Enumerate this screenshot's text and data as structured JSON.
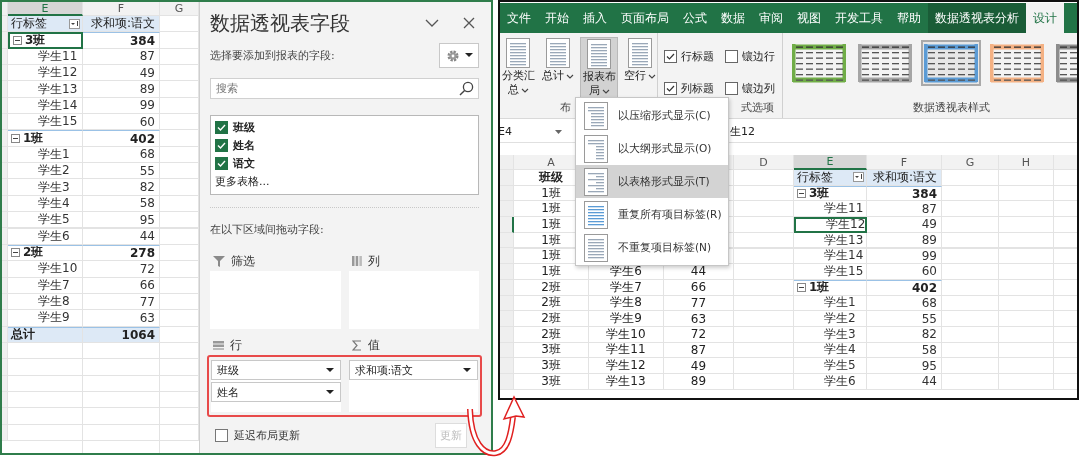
{
  "left_sheet": {
    "columns": [
      {
        "label": "E",
        "selected": true
      },
      {
        "label": "F",
        "selected": false
      },
      {
        "label": "G",
        "selected": false
      }
    ],
    "pivot": {
      "header": {
        "label": "行标签",
        "value": "求和项:语文"
      },
      "rows": [
        {
          "kind": "group",
          "label": "3班",
          "value": "384",
          "selected": true
        },
        {
          "kind": "item",
          "label": "学生11",
          "value": "87",
          "selected": false
        },
        {
          "kind": "item",
          "label": "学生12",
          "value": "49",
          "selected": false
        },
        {
          "kind": "item",
          "label": "学生13",
          "value": "89",
          "selected": false
        },
        {
          "kind": "item",
          "label": "学生14",
          "value": "99",
          "selected": false
        },
        {
          "kind": "item",
          "label": "学生15",
          "value": "60",
          "selected": false
        },
        {
          "kind": "group",
          "label": "1班",
          "value": "402",
          "selected": false
        },
        {
          "kind": "item",
          "label": "学生1",
          "value": "68",
          "selected": false
        },
        {
          "kind": "item",
          "label": "学生2",
          "value": "55",
          "selected": false
        },
        {
          "kind": "item",
          "label": "学生3",
          "value": "82",
          "selected": false
        },
        {
          "kind": "item",
          "label": "学生4",
          "value": "58",
          "selected": false
        },
        {
          "kind": "item",
          "label": "学生5",
          "value": "95",
          "selected": false
        },
        {
          "kind": "item",
          "label": "学生6",
          "value": "44",
          "selected": false
        },
        {
          "kind": "group",
          "label": "2班",
          "value": "278",
          "selected": false
        },
        {
          "kind": "item",
          "label": "学生10",
          "value": "72",
          "selected": false
        },
        {
          "kind": "item",
          "label": "学生7",
          "value": "66",
          "selected": false
        },
        {
          "kind": "item",
          "label": "学生8",
          "value": "77",
          "selected": false
        },
        {
          "kind": "item",
          "label": "学生9",
          "value": "63",
          "selected": false
        },
        {
          "kind": "total",
          "label": "总计",
          "value": "1064",
          "selected": false
        }
      ]
    }
  },
  "field_pane": {
    "title": "数据透视表字段",
    "prompt": "选择要添加到报表的字段:",
    "search": {
      "placeholder": "搜索"
    },
    "fields": [
      {
        "label": "班级",
        "checked": true
      },
      {
        "label": "姓名",
        "checked": true
      },
      {
        "label": "语文",
        "checked": true
      }
    ],
    "more_link": "更多表格...",
    "areas_prompt": "在以下区域间拖动字段:",
    "areas": [
      {
        "kind": "filter",
        "label": "筛选"
      },
      {
        "kind": "columns",
        "label": "列"
      },
      {
        "kind": "rows",
        "label": "行",
        "items": [
          "班级",
          "姓名"
        ]
      },
      {
        "kind": "values",
        "label": "值",
        "items": [
          "求和项:语文"
        ]
      }
    ],
    "defer_update": {
      "label": "延迟布局更新",
      "checked": false
    },
    "update_button": {
      "label": "更新",
      "disabled": true
    }
  },
  "right_window": {
    "tabs": [
      {
        "label": "文件",
        "selected": false,
        "contextual": false
      },
      {
        "label": "开始",
        "selected": false,
        "contextual": false
      },
      {
        "label": "插入",
        "selected": false,
        "contextual": false
      },
      {
        "label": "页面布局",
        "selected": false,
        "contextual": false
      },
      {
        "label": "公式",
        "selected": false,
        "contextual": false
      },
      {
        "label": "数据",
        "selected": false,
        "contextual": false
      },
      {
        "label": "审阅",
        "selected": false,
        "contextual": false
      },
      {
        "label": "视图",
        "selected": false,
        "contextual": false
      },
      {
        "label": "开发工具",
        "selected": false,
        "contextual": false
      },
      {
        "label": "帮助",
        "selected": false,
        "contextual": false
      },
      {
        "label": "数据透视表分析",
        "selected": false,
        "contextual": true
      },
      {
        "label": "设计",
        "selected": true,
        "contextual": true
      }
    ],
    "ribbon": {
      "groups": [
        {
          "kind": "buttons",
          "label": "布",
          "buttons": [
            {
              "label": "分类汇总",
              "pressed": false
            },
            {
              "label": "总计",
              "pressed": false
            },
            {
              "label": "报表布局",
              "pressed": true
            },
            {
              "label": "空行",
              "pressed": false
            }
          ]
        },
        {
          "kind": "options",
          "label": "式选项",
          "options": [
            {
              "label": "行标题",
              "checked": true
            },
            {
              "label": "镶边行",
              "checked": false
            },
            {
              "label": "列标题",
              "checked": true
            },
            {
              "label": "镶边列",
              "checked": false
            }
          ]
        },
        {
          "kind": "styles",
          "label": "数据透视表样式",
          "styles": [
            {
              "color": "#70ad47",
              "selected": false
            },
            {
              "color": "#a5a5a5",
              "selected": false
            },
            {
              "color": "#5b9bd5",
              "selected": true
            },
            {
              "color": "#f4b183",
              "selected": false
            },
            {
              "color": "#8c8c8c",
              "selected": false
            }
          ]
        }
      ]
    },
    "formula_bar": {
      "name_box": "E4",
      "content": "生12"
    },
    "grid": {
      "columns": [
        {
          "label": "A",
          "selected": false
        },
        null,
        null,
        {
          "label": "D",
          "selected": false
        },
        {
          "label": "E",
          "selected": true
        },
        {
          "label": "F",
          "selected": false
        },
        {
          "label": "G",
          "selected": false
        },
        {
          "label": "H",
          "selected": false
        }
      ],
      "source_rows": [
        {
          "kind": "header",
          "cells": [
            "班级",
            null,
            null
          ]
        },
        {
          "kind": "data",
          "cells": [
            "1班",
            null,
            null
          ]
        },
        {
          "kind": "data",
          "cells": [
            "1班",
            null,
            null
          ]
        },
        {
          "kind": "data",
          "cells": [
            "1班",
            null,
            null
          ]
        },
        {
          "kind": "data",
          "cells": [
            "1班",
            null,
            null
          ]
        },
        {
          "kind": "data",
          "cells": [
            "1班",
            null,
            null
          ]
        },
        {
          "kind": "data",
          "cells": [
            "1班",
            "学生6",
            "44"
          ]
        },
        {
          "kind": "data",
          "cells": [
            "2班",
            "学生7",
            "66"
          ]
        },
        {
          "kind": "data",
          "cells": [
            "2班",
            "学生8",
            "77"
          ]
        },
        {
          "kind": "data",
          "cells": [
            "2班",
            "学生9",
            "63"
          ]
        },
        {
          "kind": "data",
          "cells": [
            "2班",
            "学生10",
            "72"
          ]
        },
        {
          "kind": "data",
          "cells": [
            "3班",
            "学生11",
            "87"
          ]
        },
        {
          "kind": "data",
          "cells": [
            "3班",
            "学生12",
            "49"
          ]
        },
        {
          "kind": "data",
          "cells": [
            "3班",
            "学生13",
            "89"
          ]
        }
      ],
      "pivot": {
        "header": {
          "label": "行标签",
          "value": "求和项:语文"
        },
        "rows": [
          {
            "kind": "group",
            "label": "3班",
            "value": "384",
            "selected": false
          },
          {
            "kind": "item",
            "label": "学生11",
            "value": "87",
            "selected": false
          },
          {
            "kind": "item",
            "label": "学生12",
            "value": "49",
            "selected": true
          },
          {
            "kind": "item",
            "label": "学生13",
            "value": "89",
            "selected": false
          },
          {
            "kind": "item",
            "label": "学生14",
            "value": "99",
            "selected": false
          },
          {
            "kind": "item",
            "label": "学生15",
            "value": "60",
            "selected": false
          },
          {
            "kind": "group",
            "label": "1班",
            "value": "402",
            "selected": false
          },
          {
            "kind": "item",
            "label": "学生1",
            "value": "68",
            "selected": false
          },
          {
            "kind": "item",
            "label": "学生2",
            "value": "55",
            "selected": false
          },
          {
            "kind": "item",
            "label": "学生3",
            "value": "82",
            "selected": false
          },
          {
            "kind": "item",
            "label": "学生4",
            "value": "58",
            "selected": false
          },
          {
            "kind": "item",
            "label": "学生5",
            "value": "95",
            "selected": false
          },
          {
            "kind": "item",
            "label": "学生6",
            "value": "44",
            "selected": false
          }
        ]
      }
    },
    "menu": {
      "items": [
        {
          "kind": "compact",
          "label": "以压缩形式显示(C)",
          "selected": false
        },
        {
          "kind": "outline",
          "label": "以大纲形式显示(O)",
          "selected": false
        },
        {
          "kind": "tabular",
          "label": "以表格形式显示(T)",
          "selected": true
        },
        {
          "kind": "repeat",
          "label": "重复所有项目标签(R)",
          "selected": false
        },
        {
          "kind": "norepeat",
          "label": "不重复项目标签(N)",
          "selected": false
        }
      ]
    }
  }
}
